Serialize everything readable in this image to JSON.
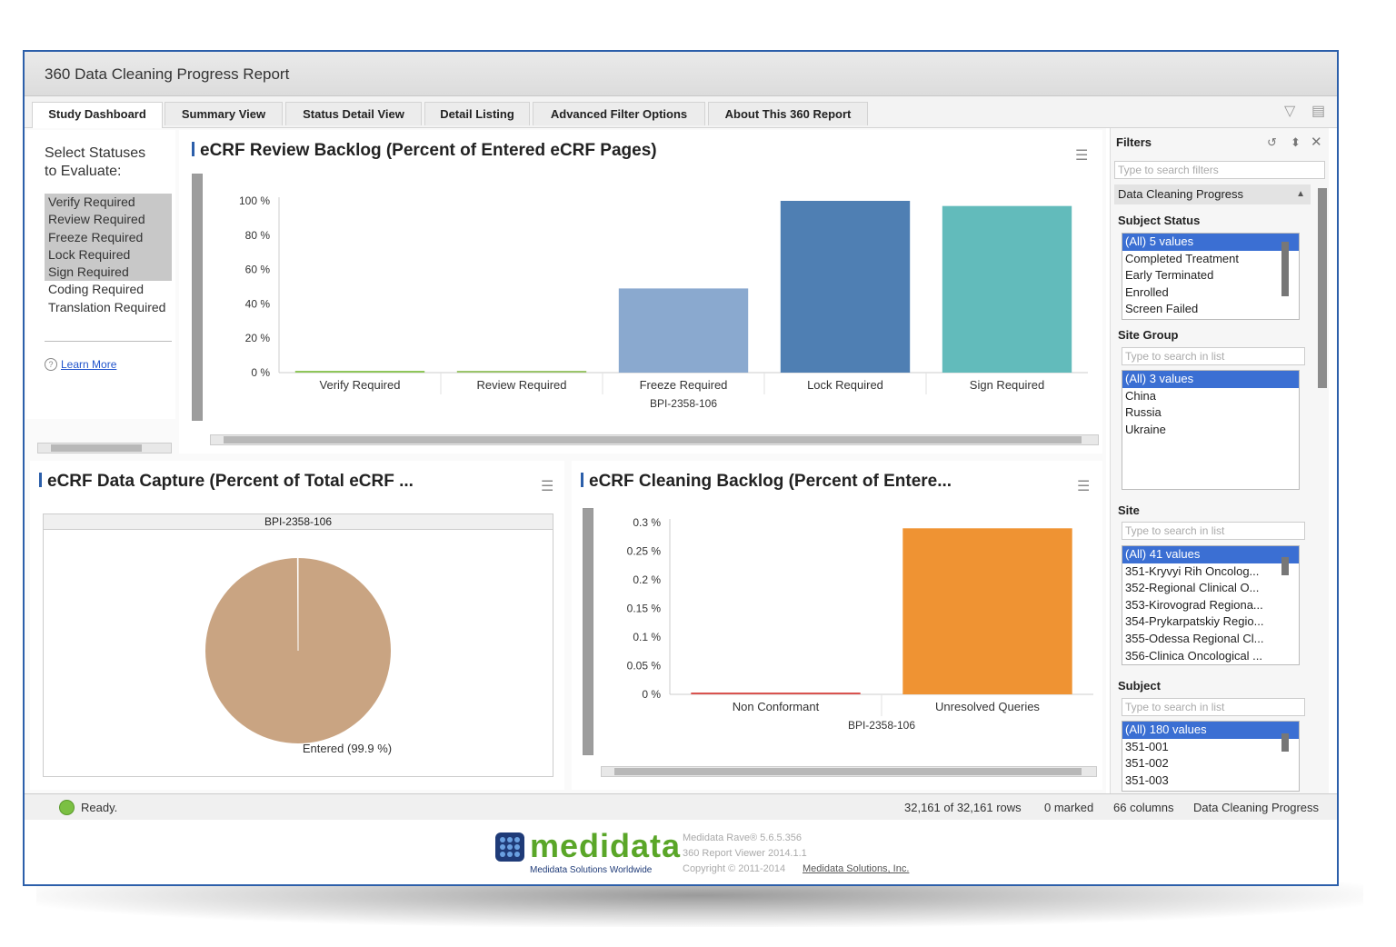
{
  "window": {
    "title": "360 Data Cleaning Progress Report"
  },
  "tabs": [
    {
      "label": "Study Dashboard",
      "active": true
    },
    {
      "label": "Summary View"
    },
    {
      "label": "Status Detail View"
    },
    {
      "label": "Detail Listing"
    },
    {
      "label": "Advanced Filter Options"
    },
    {
      "label": "About This 360 Report"
    }
  ],
  "left_panel": {
    "title": "Select Statuses\nto Evaluate:",
    "statuses": [
      {
        "label": "Verify Required",
        "selected": true
      },
      {
        "label": "Review Required",
        "selected": true
      },
      {
        "label": "Freeze Required",
        "selected": true
      },
      {
        "label": "Lock Required",
        "selected": true
      },
      {
        "label": "Sign Required",
        "selected": true
      },
      {
        "label": "Coding Required",
        "selected": false
      },
      {
        "label": "Translation Required",
        "selected": false
      }
    ],
    "learn_more": "Learn More"
  },
  "review_chart": {
    "title": "eCRF Review Backlog (Percent of Entered eCRF Pages)",
    "y_ticks": [
      "100 %",
      "80 %",
      "60 %",
      "40 %",
      "20 %",
      "0 %"
    ],
    "group_label": "BPI-2358-106"
  },
  "capture_chart": {
    "title": "eCRF Data Capture (Percent of Total eCRF ...",
    "header": "BPI-2358-106",
    "slice_label": "Entered (99.9 %)"
  },
  "cleaning_chart": {
    "title": "eCRF Cleaning Backlog (Percent of Entere...",
    "y_ticks": [
      "0.3 %",
      "0.25 %",
      "0.2 %",
      "0.15 %",
      "0.1 %",
      "0.05 %",
      "0 %"
    ],
    "group_label": "BPI-2358-106"
  },
  "chart_data": [
    {
      "type": "bar",
      "title": "eCRF Review Backlog (Percent of Entered eCRF Pages)",
      "categories": [
        "Verify Required",
        "Review Required",
        "Freeze Required",
        "Lock Required",
        "Sign Required"
      ],
      "values": [
        1,
        1,
        49,
        100,
        97
      ],
      "colors": [
        "#8fc65a",
        "#9bc56b",
        "#8aa9cf",
        "#4f7fb3",
        "#62bbbb"
      ],
      "ylim": [
        0,
        100
      ],
      "xlabel": "BPI-2358-106"
    },
    {
      "type": "pie",
      "title": "eCRF Data Capture (Percent of Total eCRF ...",
      "labels": [
        "Entered"
      ],
      "values": [
        99.9,
        0.1
      ],
      "colors": [
        "#c9a482",
        "#f5f5f5"
      ],
      "xlabel": "BPI-2358-106"
    },
    {
      "type": "bar",
      "title": "eCRF Cleaning Backlog (Percent of Entere...",
      "categories": [
        "Non Conformant",
        "Unresolved Queries"
      ],
      "values": [
        0.002,
        0.29
      ],
      "colors": [
        "#d9534f",
        "#ef9333"
      ],
      "ylim": [
        0,
        0.3
      ],
      "xlabel": "BPI-2358-106"
    }
  ],
  "filters": {
    "title": "Filters",
    "search_placeholder": "Type to search filters",
    "group": "Data Cleaning Progress",
    "list_placeholder": "Type to search in list",
    "subject_status": {
      "label": "Subject Status",
      "items": [
        "(All) 5 values",
        "Completed Treatment",
        "Early Terminated",
        "Enrolled",
        "Screen Failed"
      ]
    },
    "site_group": {
      "label": "Site Group",
      "items": [
        "(All) 3 values",
        "China",
        "Russia",
        "Ukraine"
      ]
    },
    "site": {
      "label": "Site",
      "items": [
        "(All) 41 values",
        "351-Kryvyi Rih Oncolog...",
        "352-Regional Clinical O...",
        "353-Kirovograd Regiona...",
        "354-Prykarpatskiy Regio...",
        "355-Odessa Regional Cl...",
        "356-Clinica Oncological ..."
      ]
    },
    "subject": {
      "label": "Subject",
      "items": [
        "(All) 180 values",
        "351-001",
        "351-002",
        "351-003"
      ]
    }
  },
  "status_bar": {
    "ready": "Ready.",
    "rows": "32,161 of 32,161 rows",
    "marked": "0 marked",
    "columns": "66 columns",
    "table": "Data Cleaning Progress"
  },
  "footer": {
    "logo": "medidata",
    "tagline": "Medidata Solutions Worldwide",
    "version": "Medidata Rave® 5.6.5.356",
    "viewer": "360 Report Viewer 2014.1.1",
    "copyright": "Copyright © 2011-2014",
    "company": "Medidata Solutions, Inc."
  }
}
